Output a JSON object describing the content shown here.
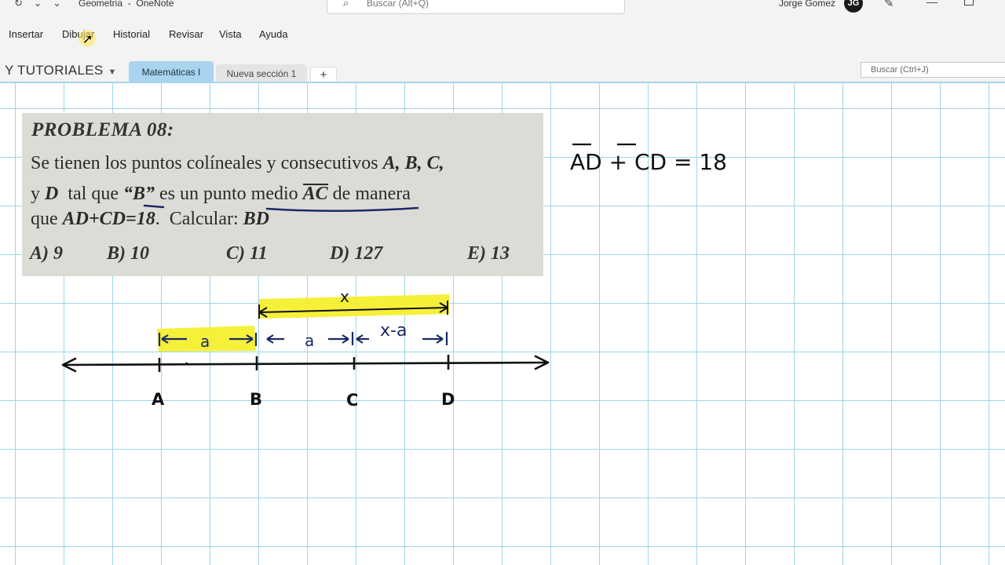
{
  "titlebar": {
    "app_title": "Geometria  -  OneNote",
    "search_placeholder": "Buscar (Alt+Q)",
    "user_name": "Jorge Gomez",
    "avatar_initials": "JG"
  },
  "ribbon": {
    "tabs": [
      "Insertar",
      "Dibujar",
      "Historial",
      "Revisar",
      "Vista",
      "Ayuda"
    ]
  },
  "notebook": {
    "name": "Y TUTORIALES"
  },
  "sections": {
    "active": "Matemáticas I",
    "other": "Nueva sección 1",
    "add": "+"
  },
  "page_search": {
    "placeholder": "Buscar (Ctrl+J)"
  },
  "problem": {
    "title": "PROBLEMA 08:",
    "options": [
      "A) 9",
      "B) 10",
      "C) 11",
      "D) 127",
      "E) 13"
    ]
  },
  "ink": {
    "equation": "AD + CD = 18",
    "point_labels": [
      "A",
      "B",
      "C",
      "D"
    ],
    "segment_labels": [
      "x",
      "a",
      "a",
      "x-a"
    ],
    "highlight_color": "#f6ef2e",
    "ink_color": "#1a2a66"
  }
}
